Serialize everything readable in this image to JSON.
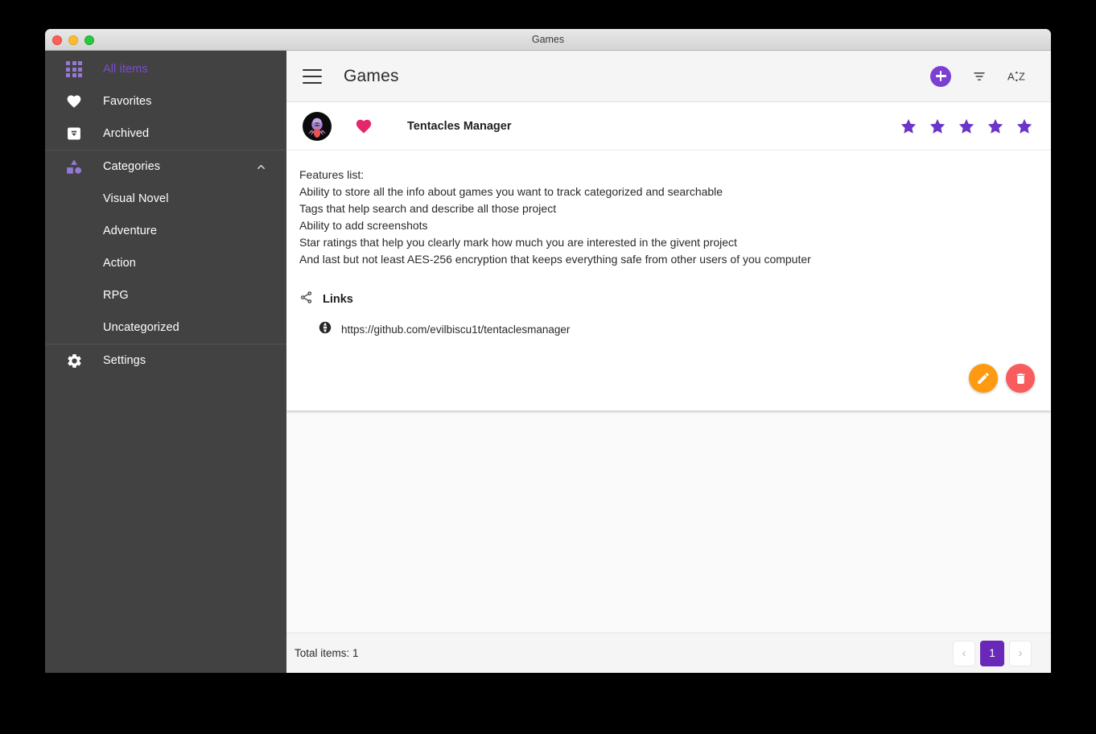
{
  "window": {
    "title": "Games",
    "controls": [
      "close-button",
      "minimize-button",
      "zoom-button"
    ]
  },
  "colors": {
    "accent_purple": "#7c3fd4",
    "sidebar_bg": "#424242",
    "active_item": "#7c4dcc",
    "heart_pink": "#e6266b",
    "star_purple": "#6a35c8",
    "edit_orange": "#fd9a11",
    "delete_red": "#f85c5c",
    "page_active": "#6a28b8"
  },
  "sidebar": {
    "items": [
      {
        "label": "All items",
        "icon": "grid-icon",
        "active": true,
        "sub": false
      },
      {
        "label": "Favorites",
        "icon": "heart-icon",
        "active": false,
        "sub": false
      },
      {
        "label": "Archived",
        "icon": "archive-icon",
        "active": false,
        "sub": false
      },
      {
        "label": "Categories",
        "icon": "shapes-icon",
        "active": false,
        "sub": false,
        "expanded": true,
        "chevron": "chevron-up-icon"
      },
      {
        "label": "Visual Novel",
        "icon": "",
        "active": false,
        "sub": true
      },
      {
        "label": "Adventure",
        "icon": "",
        "active": false,
        "sub": true
      },
      {
        "label": "Action",
        "icon": "",
        "active": false,
        "sub": true
      },
      {
        "label": "RPG",
        "icon": "",
        "active": false,
        "sub": true
      },
      {
        "label": "Uncategorized",
        "icon": "",
        "active": false,
        "sub": true
      },
      {
        "label": "Settings",
        "icon": "gear-icon",
        "active": false,
        "sub": false
      }
    ]
  },
  "toolbar": {
    "menu_icon": "hamburger-menu-icon",
    "title": "Games",
    "add_icon": "add-plus-icon",
    "filter_icon": "filter-icon",
    "sort_icon": "sort-alpha-icon",
    "sort_label_a": "A",
    "sort_label_z": "Z"
  },
  "item": {
    "avatar_icon": "octopus-avatar",
    "favorite_icon": "heart-filled-icon",
    "favorite": true,
    "title": "Tentacles Manager",
    "rating": 5,
    "max_rating": 5
  },
  "detail": {
    "features": [
      "Features list:",
      "Ability to store all the info about games you want to track categorized and searchable",
      "Tags that help search and describe all those project",
      "Ability to add screenshots",
      "Star ratings that help you clearly mark how much you are interested in the givent project",
      "And last but not least AES-256 encryption that keeps everything safe from other users of you computer"
    ],
    "links_icon": "share-icon",
    "links_title": "Links",
    "links": [
      {
        "icon": "globe-icon",
        "url": "https://github.com/evilbiscu1t/tentaclesmanager"
      }
    ],
    "actions": [
      {
        "name": "edit-button",
        "icon": "pencil-icon"
      },
      {
        "name": "delete-button",
        "icon": "trash-icon"
      }
    ]
  },
  "footer": {
    "total_items": "Total items: 1",
    "prev_label": "‹",
    "next_label": "›",
    "current_page": "1"
  }
}
